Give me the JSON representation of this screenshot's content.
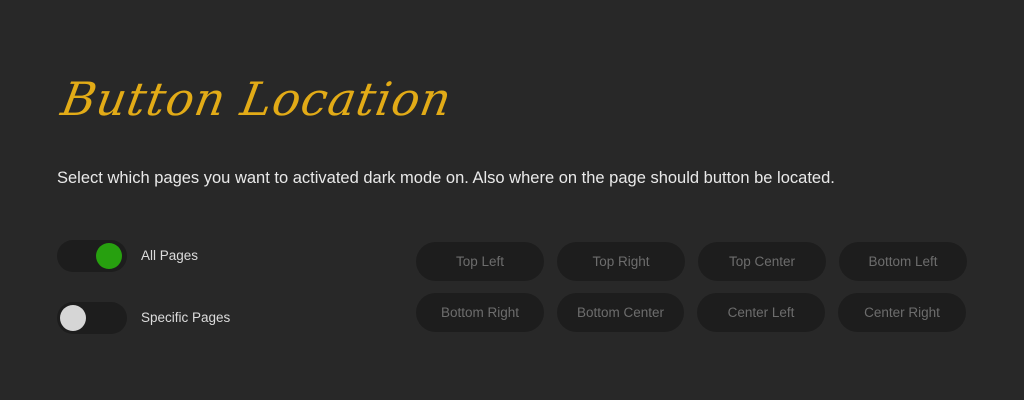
{
  "header": {
    "title": "Button Location",
    "description": "Select which pages you want to activated dark mode on. Also where on the page should button be located."
  },
  "page_toggles": [
    {
      "label": "All Pages",
      "checked": true
    },
    {
      "label": "Specific Pages",
      "checked": false
    }
  ],
  "location_buttons": {
    "row1": [
      "Top Left",
      "Top Right",
      "Top Center",
      "Bottom Left"
    ],
    "row2": [
      "Bottom Right",
      "Bottom Center",
      "Center Left",
      "Center Right"
    ]
  },
  "colors": {
    "background": "#282828",
    "accent_title": "#e2ab17",
    "toggle_on": "#27a00f",
    "toggle_off_knob": "#d6d6d6",
    "button_bg": "#1d1d1d",
    "button_text": "#6d6d6d"
  }
}
